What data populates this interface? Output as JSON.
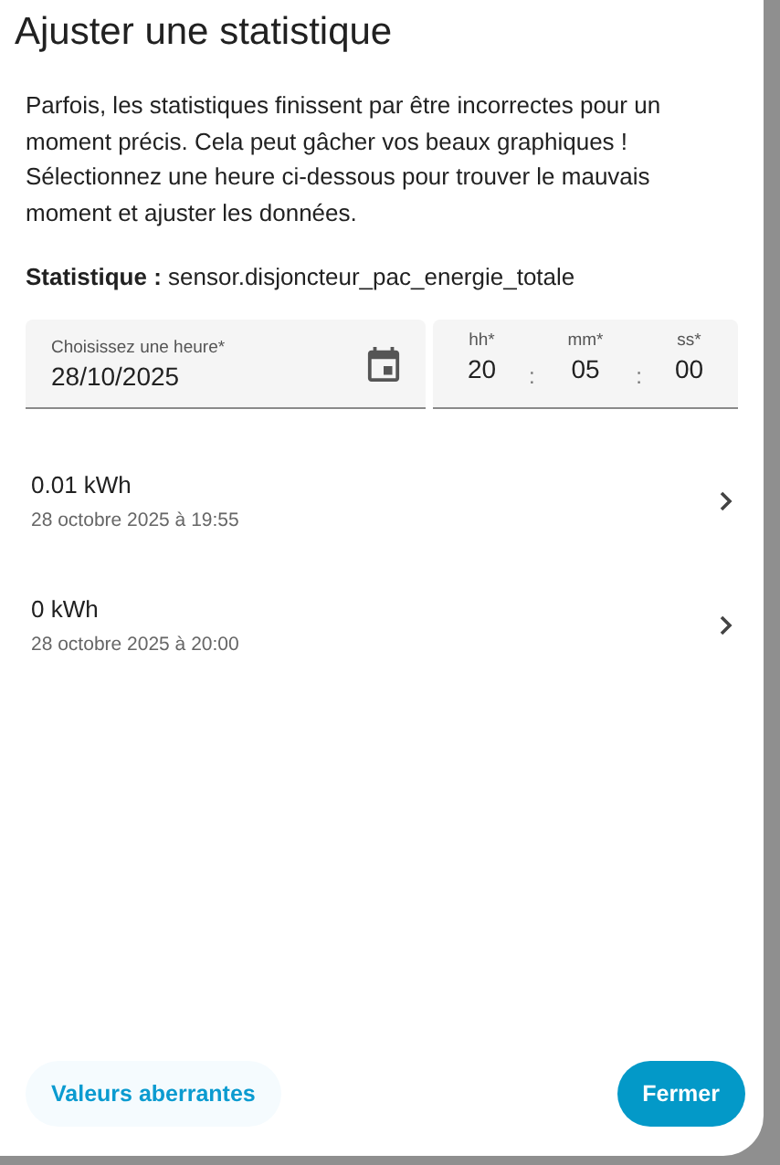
{
  "dialog": {
    "title": "Ajuster une statistique",
    "description": "Parfois, les statistiques finissent par être incorrectes pour un moment précis. Cela peut gâcher vos beaux graphiques ! Sélectionnez une heure ci-dessous pour trouver le mauvais moment et ajuster les données.",
    "statistic": {
      "label": "Statistique :",
      "value": "sensor.disjoncteur_pac_energie_totale"
    },
    "date_field": {
      "label": "Choisissez une heure*",
      "value": "28/10/2025"
    },
    "time_field": [
      {
        "label": "hh*",
        "value": "20"
      },
      {
        "label": "mm*",
        "value": "05"
      },
      {
        "label": "ss*",
        "value": "00"
      }
    ],
    "time_separators": [
      ":",
      ":"
    ],
    "entries": [
      {
        "value": "0.01 kWh",
        "time": "28 octobre 2025 à 19:55"
      },
      {
        "value": "0 kWh",
        "time": "28 octobre 2025 à 20:00"
      }
    ],
    "buttons": [
      {
        "label": "Valeurs aberrantes",
        "kind": "tonal"
      },
      {
        "label": "Fermer",
        "kind": "filled"
      }
    ]
  }
}
